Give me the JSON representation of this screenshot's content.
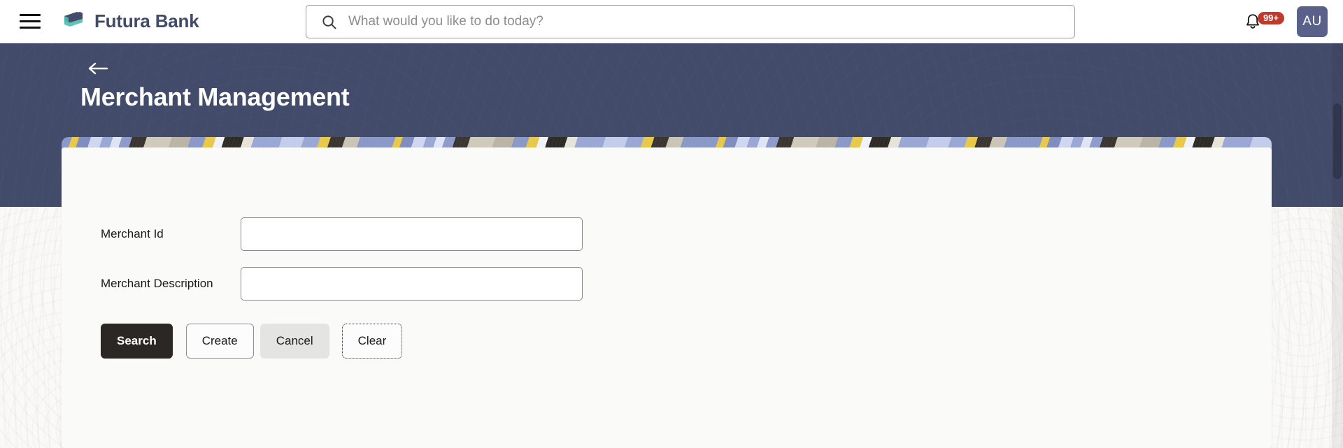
{
  "navbar": {
    "menu_icon": "hamburger-menu-icon",
    "brand_name": "Futura Bank",
    "brand_logo_icon": "stacked-cards-logo",
    "search": {
      "icon": "search-icon",
      "value": "",
      "placeholder": "What would you like to do today?"
    },
    "notifications": {
      "icon": "bell-icon",
      "badge": "99+",
      "badge_color": "#c0392b"
    },
    "avatar": {
      "initials": "AU",
      "color": "#59618a"
    }
  },
  "hero": {
    "back_icon": "back-arrow-icon",
    "title": "Merchant Management",
    "background_color": "#434b6b"
  },
  "form": {
    "fields": [
      {
        "label": "Merchant Id",
        "value": "",
        "placeholder": ""
      },
      {
        "label": "Merchant Description",
        "value": "",
        "placeholder": ""
      }
    ],
    "buttons": [
      {
        "label": "Search",
        "style": "primary"
      },
      {
        "label": "Create",
        "style": "outline"
      },
      {
        "label": "Cancel",
        "style": "ghost"
      },
      {
        "label": "Clear",
        "style": "dashed"
      }
    ]
  },
  "scrollbar": {
    "orientation": "vertical"
  }
}
